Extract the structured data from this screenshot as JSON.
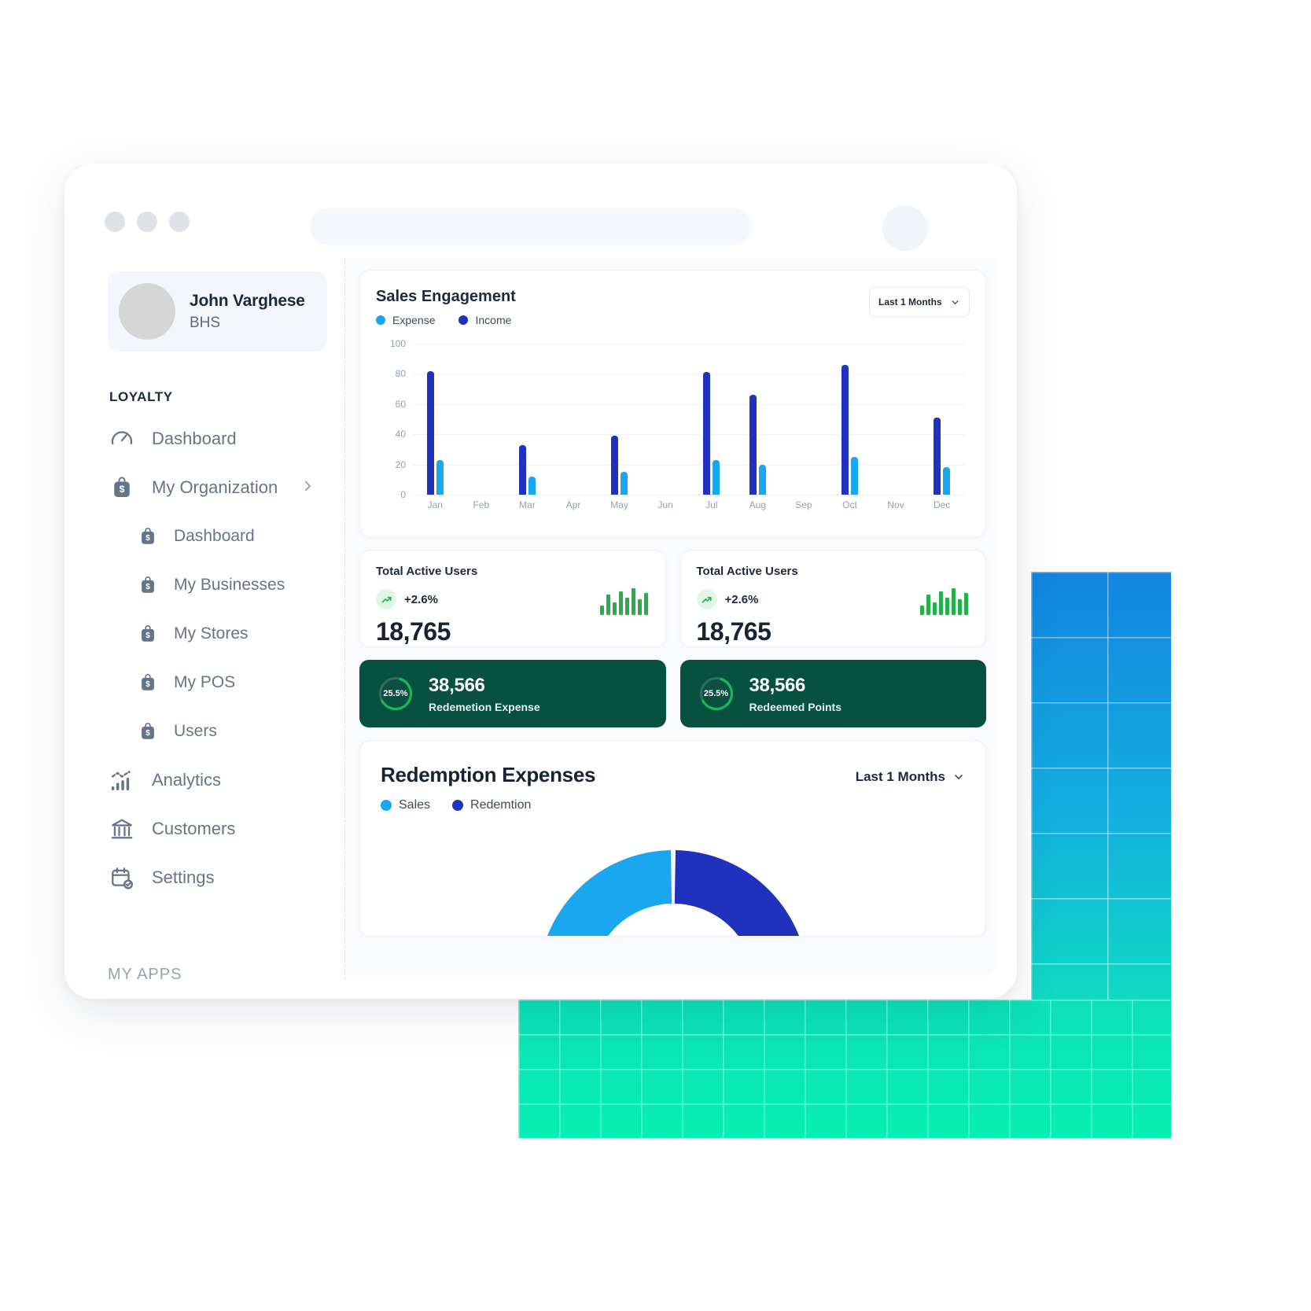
{
  "window": {
    "traffic_dots": 3,
    "url_placeholder": ""
  },
  "sidebar": {
    "profile": {
      "name": "John Varghese",
      "org": "BHS"
    },
    "section_label": "LOYALTY",
    "items": [
      {
        "label": "Dashboard",
        "icon": "gauge-icon",
        "level": 0,
        "expandable": false
      },
      {
        "label": "My Organization",
        "icon": "bag-dollar-icon",
        "level": 0,
        "expandable": true
      },
      {
        "label": "Dashboard",
        "icon": "bag-dollar-icon",
        "level": 1,
        "expandable": false
      },
      {
        "label": "My Businesses",
        "icon": "bag-dollar-icon",
        "level": 1,
        "expandable": false
      },
      {
        "label": "My Stores",
        "icon": "bag-dollar-icon",
        "level": 1,
        "expandable": false
      },
      {
        "label": "My POS",
        "icon": "bag-dollar-icon",
        "level": 1,
        "expandable": false
      },
      {
        "label": "Users",
        "icon": "bag-dollar-icon",
        "level": 1,
        "expandable": false
      },
      {
        "label": "Analytics",
        "icon": "bar-chart-icon",
        "level": 0,
        "expandable": false
      },
      {
        "label": "Customers",
        "icon": "bank-icon",
        "level": 0,
        "expandable": false
      },
      {
        "label": "Settings",
        "icon": "calendar-check-icon",
        "level": 0,
        "expandable": false
      }
    ],
    "clipped_text": "MY APPS"
  },
  "sales_card": {
    "title": "Sales Engagement",
    "range_value": "Last 1 Months",
    "legend": [
      {
        "label": "Expense",
        "color": "#1ba7ef"
      },
      {
        "label": "Income",
        "color": "#1f31bd"
      }
    ]
  },
  "chart_data": {
    "type": "bar",
    "title": "Sales Engagement",
    "xlabel": "",
    "ylabel": "",
    "ylim": [
      0,
      100
    ],
    "yticks": [
      0,
      20,
      40,
      60,
      80,
      100
    ],
    "ytick_labels": [
      "0",
      "20",
      "40",
      "60",
      "80",
      "100"
    ],
    "grid": true,
    "legend_position": "top-left",
    "categories": [
      "Jan",
      "Feb",
      "Mar",
      "Apr",
      "May",
      "Jun",
      "Jul",
      "Aug",
      "Sep",
      "Oct",
      "Nov",
      "Dec"
    ],
    "series": [
      {
        "name": "Income",
        "color": "#1f31bd",
        "values": [
          82,
          0,
          33,
          0,
          39,
          0,
          81,
          66,
          0,
          86,
          0,
          51
        ]
      },
      {
        "name": "Expense",
        "color": "#1ba7ef",
        "values": [
          23,
          0,
          12,
          0,
          15,
          0,
          23,
          20,
          0,
          25,
          0,
          18
        ]
      }
    ]
  },
  "stat_cards": [
    {
      "title": "Total Active Users",
      "delta": "+2.6%",
      "value": "18,765",
      "spark": [
        12,
        26,
        16,
        30,
        22,
        34,
        20,
        28
      ],
      "spark_color": "#24b14b",
      "delta_color": "#24b14b"
    },
    {
      "title": "Total Active Users",
      "delta": "+2.6%",
      "value": "18,765",
      "spark": [
        12,
        26,
        16,
        30,
        22,
        34,
        20,
        28
      ],
      "spark_color": "#24b14b",
      "delta_color": "#24b14b"
    }
  ],
  "green_cards": [
    {
      "percent": "25.5%",
      "value": "38,566",
      "label": "Redemetion Expense",
      "bg": "#08503f",
      "ring": "#17b75a"
    },
    {
      "percent": "25.5%",
      "value": "38,566",
      "label": "Redeemed Points",
      "bg": "#08503f",
      "ring": "#17b75a"
    }
  ],
  "redemption_card": {
    "title": "Redemption Expenses",
    "range_value": "Last 1 Months",
    "legend": [
      {
        "label": "Sales",
        "color": "#1ba7ef"
      },
      {
        "label": "Redemtion",
        "color": "#1f31bd"
      }
    ],
    "gauge": {
      "type": "pie",
      "segments": [
        {
          "name": "Sales",
          "color": "#1ba7ef",
          "share": 0.5
        },
        {
          "name": "Redemtion",
          "color": "#1f31bd",
          "share": 0.5
        }
      ]
    }
  },
  "colors": {
    "accent_blue": "#1ba7ef",
    "accent_indigo": "#1f31bd",
    "green_dark": "#08503f",
    "green_bright": "#17b75a",
    "text_dark": "#152334",
    "text_muted": "#64748b"
  }
}
